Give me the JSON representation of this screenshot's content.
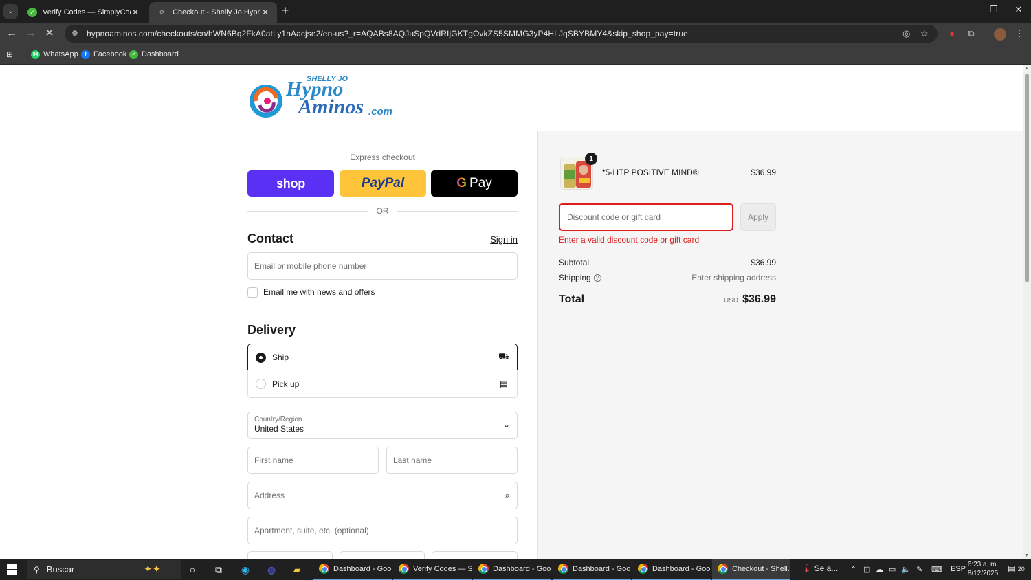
{
  "browser": {
    "tabs": [
      {
        "title": "Verify Codes — SimplyCodes",
        "active": false
      },
      {
        "title": "Checkout - Shelly Jo Hypno Am",
        "active": true
      }
    ],
    "url": "hypnoaminos.com/checkouts/cn/hWN6Bq2FkA0atLy1nAacjse2/en-us?_r=AQABs8AQJuSpQVdRIjGKTgOvkZS5SMMG3yP4HLJqSBYBMY4&skip_shop_pay=true",
    "bookmarks": [
      {
        "label": "WhatsApp",
        "badge": "94"
      },
      {
        "label": "Facebook"
      },
      {
        "label": "Dashboard"
      }
    ]
  },
  "logo": {
    "line1": "SHELLY JO",
    "line2": "Hypno",
    "line3": "Aminos",
    "suffix": ".com"
  },
  "checkout": {
    "express_label": "Express checkout",
    "shop_label": "shop",
    "paypal_label": "PayPal",
    "gpay_label": "Pay",
    "or_label": "OR",
    "contact_title": "Contact",
    "signin_label": "Sign in",
    "email_placeholder": "Email or mobile phone number",
    "newsletter_label": "Email me with news and offers",
    "delivery_title": "Delivery",
    "delivery_options": [
      {
        "label": "Ship",
        "selected": true,
        "icon": "truck-icon"
      },
      {
        "label": "Pick up",
        "selected": false,
        "icon": "store-icon"
      }
    ],
    "country_label": "Country/Region",
    "country_value": "United States",
    "first_name_placeholder": "First name",
    "last_name_placeholder": "Last name",
    "address_placeholder": "Address",
    "apartment_placeholder": "Apartment, suite, etc. (optional)"
  },
  "summary": {
    "product_name": "*5-HTP POSITIVE MIND®",
    "product_qty": "1",
    "product_price": "$36.99",
    "discount_placeholder": "Discount code or gift card",
    "apply_label": "Apply",
    "error_text": "Enter a valid discount code or gift card",
    "subtotal_label": "Subtotal",
    "subtotal_value": "$36.99",
    "shipping_label": "Shipping",
    "shipping_value": "Enter shipping address",
    "total_label": "Total",
    "currency": "USD",
    "total_value": "$36.99"
  },
  "taskbar": {
    "search_placeholder": "Buscar",
    "tasks": [
      {
        "title": "Dashboard - Goo...",
        "active": false
      },
      {
        "title": "Verify Codes — S...",
        "active": false
      },
      {
        "title": "Dashboard - Goo...",
        "active": false
      },
      {
        "title": "Dashboard - Goo...",
        "active": false
      },
      {
        "title": "Dashboard - Goo...",
        "active": false
      },
      {
        "title": "Checkout - Shell...",
        "active": true
      }
    ],
    "weather_label": "Se a...",
    "language": "ESP",
    "time": "6:23 a. m.",
    "date": "8/12/2025",
    "notifications": "20"
  },
  "colors": {
    "shop_pay": "#5a31f4",
    "paypal": "#ffc439",
    "error": "#dd1d1d"
  }
}
